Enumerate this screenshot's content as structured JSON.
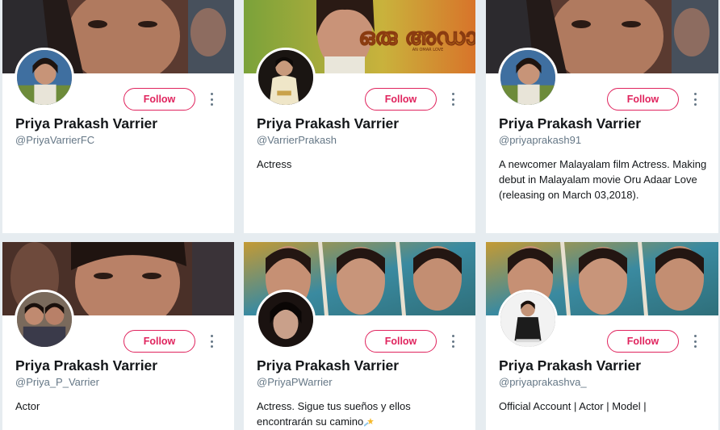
{
  "follow_label": "Follow",
  "accent_color": "#e0245e",
  "cards": [
    {
      "name": "Priya Prakash Varrier",
      "handle": "@PriyaVarrierFC",
      "bio": ""
    },
    {
      "name": "Priya Prakash Varrier",
      "handle": "@VarrierPrakash",
      "bio": "Actress",
      "banner_text": "AN OMAR LOVE"
    },
    {
      "name": "Priya Prakash Varrier",
      "handle": "@priyaprakash91",
      "bio": "A newcomer Malayalam film Actress. Making debut in Malayalam movie Oru Adaar Love (releasing on March 03,2018)."
    },
    {
      "name": "Priya Prakash Varrier",
      "handle": "@Priya_P_Varrier",
      "bio": "Actor"
    },
    {
      "name": "Priya Prakash Varrier",
      "handle": "@PriyaPWarrier",
      "bio": "Actress. Sigue tus sueños y ellos encontrarán su camino",
      "bio_emoji": "shooting-star-icon"
    },
    {
      "name": "Priya Prakash Varrier",
      "handle": "@priyaprakashva_",
      "bio": "Official Account | Actor | Model |"
    }
  ]
}
